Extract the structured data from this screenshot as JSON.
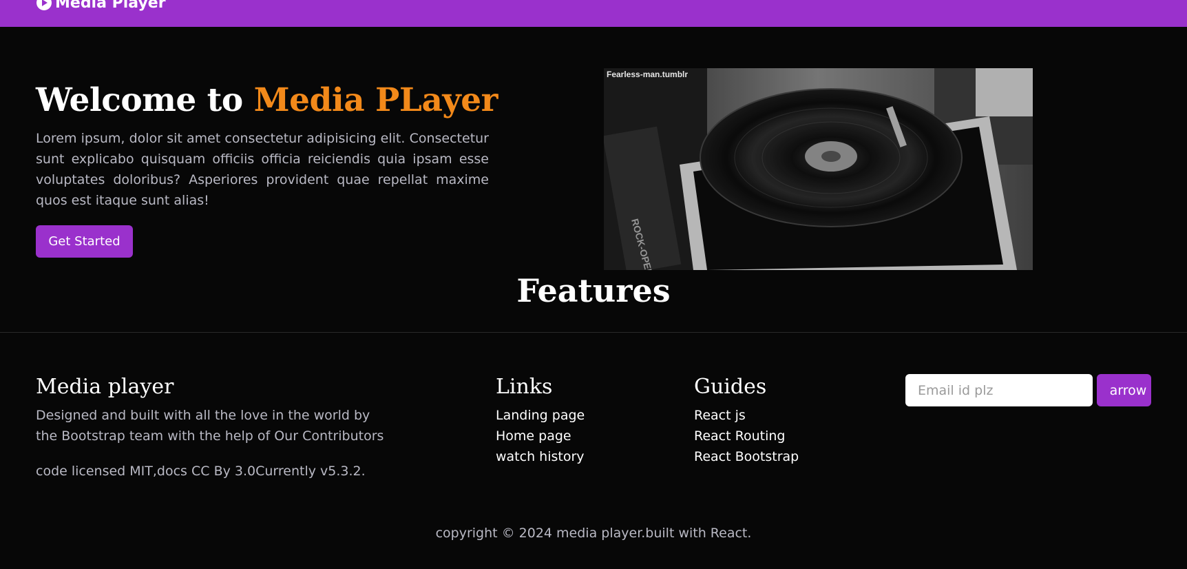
{
  "navbar": {
    "brand_label": "Media Player",
    "brand_icon": "play-circle-icon",
    "color": "#9a31cc"
  },
  "hero": {
    "title_prefix": "Welcome to ",
    "title_accent": "Media PLayer",
    "accent_color": "#f2891a",
    "description": "Lorem ipsum, dolor sit amet consectetur adipisicing elit. Consectetur sunt explicabo quisquam officiis officia reiciendis quia ipsam esse voluptates doloribus? Asperiores provident quae repellat maxime quos est itaque sunt alias!",
    "cta_label": "Get Started",
    "image_caption": "Fearless-man.tumblr"
  },
  "features": {
    "title": "Features"
  },
  "footer": {
    "about": {
      "title": "Media player",
      "description": "Designed and built with all the love in the world by the Bootstrap team with the help of Our Contributors",
      "license": "code licensed MIT,docs CC By 3.0Currently v5.3.2."
    },
    "links": {
      "title": "Links",
      "items": [
        "Landing page",
        "Home page",
        "watch history"
      ]
    },
    "guides": {
      "title": "Guides",
      "items": [
        "React js",
        "React Routing",
        "React Bootstrap"
      ]
    },
    "subscribe": {
      "placeholder": "Email id plz",
      "button_label": "arrow"
    },
    "copyright": "copyright © 2024 media player.built with React."
  }
}
